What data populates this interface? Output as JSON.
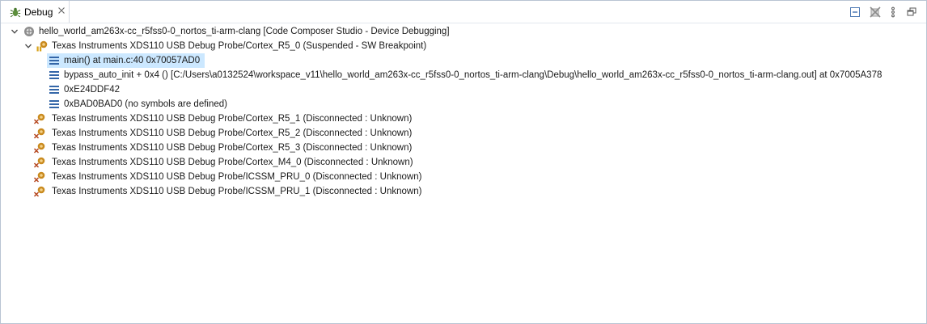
{
  "tab": {
    "label": "Debug"
  },
  "toolbar": {
    "collapse_all": "collapse-all-icon",
    "remove_terminated": "remove-terminated-icon",
    "view_menu": "view-menu-icon",
    "minimize": "minimize-icon"
  },
  "tree": {
    "session": "hello_world_am263x-cc_r5fss0-0_nortos_ti-arm-clang [Code Composer Studio - Device Debugging]",
    "core_active": "Texas Instruments XDS110 USB Debug Probe/Cortex_R5_0 (Suspended - SW Breakpoint)",
    "frames": [
      "main() at main.c:40 0x70057AD0",
      "bypass_auto_init + 0x4 () [C:/Users\\a0132524\\workspace_v11\\hello_world_am263x-cc_r5fss0-0_nortos_ti-arm-clang\\Debug\\hello_world_am263x-cc_r5fss0-0_nortos_ti-arm-clang.out] at 0x7005A378",
      "0xE24DDF42",
      "0xBAD0BAD0  (no symbols are defined)"
    ],
    "cores_disconnected": [
      "Texas Instruments XDS110 USB Debug Probe/Cortex_R5_1 (Disconnected : Unknown)",
      "Texas Instruments XDS110 USB Debug Probe/Cortex_R5_2 (Disconnected : Unknown)",
      "Texas Instruments XDS110 USB Debug Probe/Cortex_R5_3 (Disconnected : Unknown)",
      "Texas Instruments XDS110 USB Debug Probe/Cortex_M4_0 (Disconnected : Unknown)",
      "Texas Instruments XDS110 USB Debug Probe/ICSSM_PRU_0 (Disconnected : Unknown)",
      "Texas Instruments XDS110 USB Debug Probe/ICSSM_PRU_1 (Disconnected : Unknown)"
    ]
  }
}
